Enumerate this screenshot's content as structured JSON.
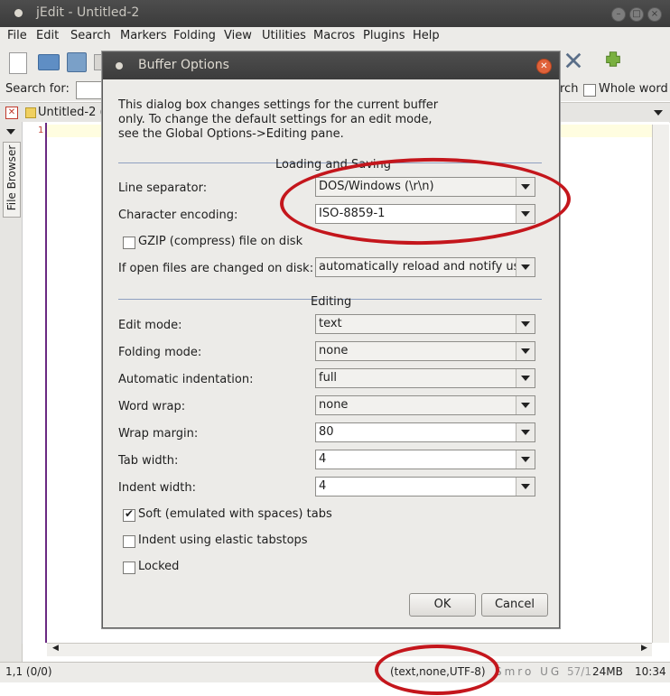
{
  "window": {
    "title": "jEdit - Untitled-2"
  },
  "menu": [
    "File",
    "Edit",
    "Search",
    "Markers",
    "Folding",
    "View",
    "Utilities",
    "Macros",
    "Plugins",
    "Help"
  ],
  "searchbar": {
    "label": "Search for:",
    "right_partial": "rch",
    "whole_word": "Whole word"
  },
  "buffer_tab": {
    "label": "Untitled-2 ("
  },
  "side_tab": "File Browser",
  "gutter_line": "1",
  "statusbar": {
    "position": "1,1 (0/0)",
    "mode": "(text,none,UTF-8)",
    "flags": "Smro UG",
    "lines": "57/1",
    "memory": "24MB",
    "time": "10:34"
  },
  "dialog": {
    "title": "Buffer Options",
    "intro": "This dialog box changes settings for the current buffer only. To change the default settings for an edit mode, see the Global Options->Editing pane.",
    "section_loading": "Loading and Saving",
    "line_separator": {
      "label": "Line separator:",
      "value": "DOS/Windows (\\r\\n)"
    },
    "encoding": {
      "label": "Character encoding:",
      "value": "ISO-8859-1"
    },
    "gzip": {
      "label": "GZIP (compress) file on disk",
      "checked": false
    },
    "open_changed": {
      "label": "If open files are changed on disk:",
      "value": "automatically reload and notify user"
    },
    "section_editing": "Editing",
    "edit_mode": {
      "label": "Edit mode:",
      "value": "text"
    },
    "folding_mode": {
      "label": "Folding mode:",
      "value": "none"
    },
    "auto_indent": {
      "label": "Automatic indentation:",
      "value": "full"
    },
    "word_wrap": {
      "label": "Word wrap:",
      "value": "none"
    },
    "wrap_margin": {
      "label": "Wrap margin:",
      "value": "80"
    },
    "tab_width": {
      "label": "Tab width:",
      "value": "4"
    },
    "indent_width": {
      "label": "Indent width:",
      "value": "4"
    },
    "soft_tabs": {
      "label": "Soft (emulated with spaces) tabs",
      "checked": true
    },
    "elastic": {
      "label": "Indent using elastic tabstops",
      "checked": false
    },
    "locked": {
      "label": "Locked",
      "checked": false
    },
    "ok": "OK",
    "cancel": "Cancel"
  },
  "colors": {
    "annotation_red": "#c4161c",
    "gutter_accent": "#6a2a82",
    "close_orange": "#e0623a"
  },
  "icons": [
    "new-file-icon",
    "open-file-icon",
    "save-icon",
    "close-icon",
    "cut-tool-icon",
    "plugin-icon"
  ]
}
